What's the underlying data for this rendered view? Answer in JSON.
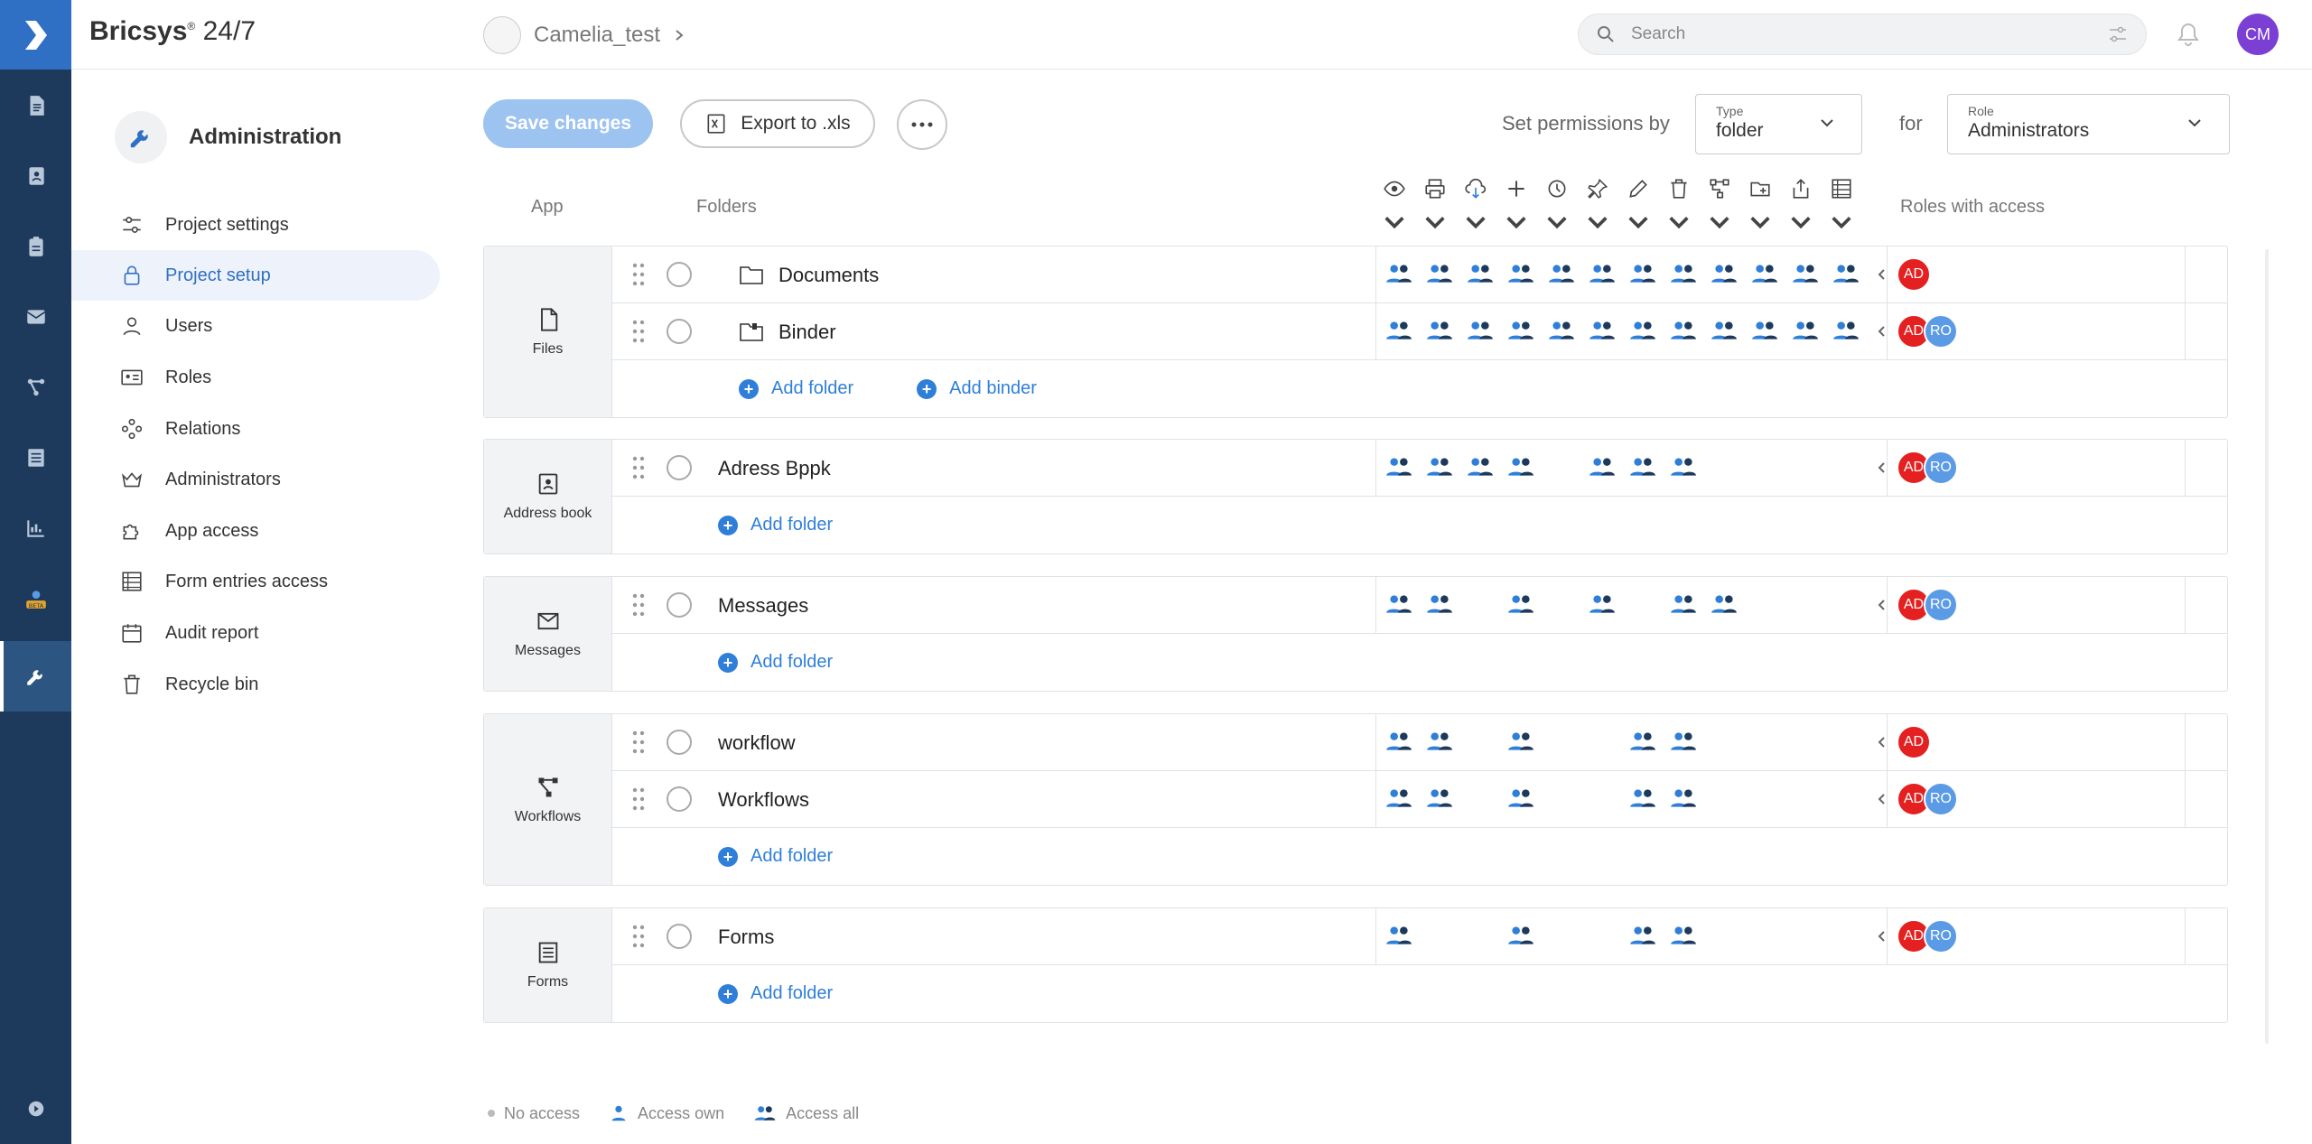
{
  "brand": {
    "name": "Bricsys",
    "suffix": "24/7"
  },
  "breadcrumb": {
    "project": "Camelia_test"
  },
  "search": {
    "placeholder": "Search"
  },
  "user": {
    "initials": "CM"
  },
  "admin_title": "Administration",
  "nav": [
    {
      "label": "Project settings",
      "icon": "sliders-icon",
      "active": false
    },
    {
      "label": "Project setup",
      "icon": "lock-icon",
      "active": true
    },
    {
      "label": "Users",
      "icon": "user-icon",
      "active": false
    },
    {
      "label": "Roles",
      "icon": "id-card-icon",
      "active": false
    },
    {
      "label": "Relations",
      "icon": "network-icon",
      "active": false
    },
    {
      "label": "Administrators",
      "icon": "crown-icon",
      "active": false
    },
    {
      "label": "App access",
      "icon": "puzzle-icon",
      "active": false
    },
    {
      "label": "Form entries access",
      "icon": "table-icon",
      "active": false
    },
    {
      "label": "Audit report",
      "icon": "calendar-icon",
      "active": false
    },
    {
      "label": "Recycle bin",
      "icon": "trash-icon",
      "active": false
    }
  ],
  "toolbar": {
    "save_label": "Save changes",
    "export_label": "Export to .xls",
    "set_by_label": "Set permissions by",
    "type_label": "Type",
    "type_value": "folder",
    "for_label": "for",
    "role_label": "Role",
    "role_value": "Administrators"
  },
  "columns": {
    "app": "App",
    "folders": "Folders",
    "roles": "Roles with access"
  },
  "permission_icons": [
    "eye-icon",
    "print-icon",
    "cloud-download-icon",
    "plus-icon",
    "history-icon",
    "pin-icon",
    "edit-icon",
    "trash-icon",
    "workflow-icon",
    "folder-add-icon",
    "share-icon",
    "table-icon"
  ],
  "groups": [
    {
      "app": "Files",
      "icon": "file-icon",
      "rows": [
        {
          "name": "Documents",
          "kind": "folder",
          "perms": [
            1,
            1,
            1,
            1,
            1,
            1,
            1,
            1,
            1,
            1,
            1,
            1
          ],
          "roles": [
            "AD"
          ]
        },
        {
          "name": "Binder",
          "kind": "binder",
          "perms": [
            1,
            1,
            1,
            1,
            1,
            1,
            1,
            1,
            1,
            1,
            1,
            1
          ],
          "roles": [
            "AD",
            "RO"
          ]
        }
      ],
      "add": [
        "Add folder",
        "Add binder"
      ]
    },
    {
      "app": "Address book",
      "icon": "contact-icon",
      "rows": [
        {
          "name": "Adress Bppk",
          "kind": "plain",
          "perms": [
            1,
            1,
            1,
            1,
            0,
            1,
            1,
            1,
            0,
            0,
            0,
            0
          ],
          "roles": [
            "AD",
            "RO"
          ]
        }
      ],
      "add": [
        "Add folder"
      ]
    },
    {
      "app": "Messages",
      "icon": "mail-icon",
      "rows": [
        {
          "name": "Messages",
          "kind": "plain",
          "perms": [
            1,
            1,
            0,
            1,
            0,
            1,
            0,
            1,
            1,
            0,
            0,
            0
          ],
          "roles": [
            "AD",
            "RO"
          ]
        }
      ],
      "add": [
        "Add folder"
      ]
    },
    {
      "app": "Workflows",
      "icon": "workflow-icon",
      "rows": [
        {
          "name": "workflow",
          "kind": "plain",
          "perms": [
            1,
            1,
            0,
            1,
            0,
            0,
            1,
            1,
            0,
            0,
            0,
            0
          ],
          "roles": [
            "AD"
          ]
        },
        {
          "name": "Workflows",
          "kind": "plain",
          "perms": [
            1,
            1,
            0,
            1,
            0,
            0,
            1,
            1,
            0,
            0,
            0,
            0
          ],
          "roles": [
            "AD",
            "RO"
          ]
        }
      ],
      "add": [
        "Add folder"
      ]
    },
    {
      "app": "Forms",
      "icon": "form-icon",
      "rows": [
        {
          "name": "Forms",
          "kind": "plain",
          "perms": [
            1,
            0,
            0,
            1,
            0,
            0,
            1,
            1,
            0,
            0,
            0,
            0
          ],
          "roles": [
            "AD",
            "RO"
          ]
        }
      ],
      "add": [
        "Add folder"
      ]
    }
  ],
  "legend": {
    "none": "No access",
    "own": "Access own",
    "all": "Access all"
  },
  "colors": {
    "rail": "#1d3a5c",
    "accent": "#2f7fd9",
    "admin_role": "#e42020",
    "ro_role": "#5b9be6"
  }
}
